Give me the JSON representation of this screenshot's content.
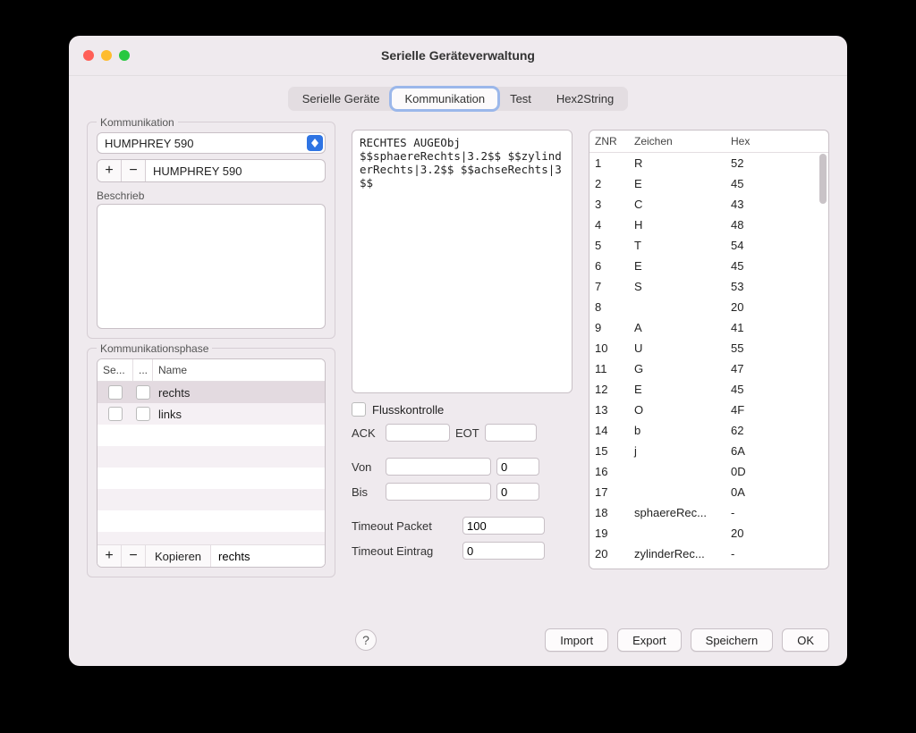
{
  "window": {
    "title": "Serielle Geräteverwaltung"
  },
  "tabs": [
    "Serielle Geräte",
    "Kommunikation",
    "Test",
    "Hex2String"
  ],
  "active_tab": 1,
  "komm": {
    "group_label": "Kommunikation",
    "device_selected": "HUMPHREY 590",
    "add_label": "+",
    "remove_label": "−",
    "device_inline": "HUMPHREY 590",
    "beschrieb_label": "Beschrieb"
  },
  "phase": {
    "group_label": "Kommunikationsphase",
    "headers": {
      "se": "Se...",
      "dots": "...",
      "name": "Name"
    },
    "rows": [
      {
        "name": "rechts",
        "selected": true
      },
      {
        "name": "links",
        "selected": false
      }
    ],
    "copy_label": "Kopieren",
    "copy_value": "rechts"
  },
  "code_text": "RECHTES AUGEObj\n$$sphaereRechts|3.2$$ $$zylinderRechts|3.2$$ $$achseRechts|3$$",
  "fluss": {
    "label": "Flusskontrolle",
    "ack_label": "ACK",
    "ack_value": "",
    "eot_label": "EOT",
    "eot_value": ""
  },
  "range": {
    "von_label": "Von",
    "von_a": "",
    "von_b": "0",
    "bis_label": "Bis",
    "bis_a": "",
    "bis_b": "0"
  },
  "timeout": {
    "packet_label": "Timeout Packet",
    "packet_value": "100",
    "eintrag_label": "Timeout Eintrag",
    "eintrag_value": "0"
  },
  "table": {
    "headers": {
      "znr": "ZNR",
      "zeichen": "Zeichen",
      "hex": "Hex"
    },
    "rows": [
      {
        "znr": "1",
        "z": "R",
        "h": "52"
      },
      {
        "znr": "2",
        "z": "E",
        "h": "45"
      },
      {
        "znr": "3",
        "z": "C",
        "h": "43"
      },
      {
        "znr": "4",
        "z": "H",
        "h": "48"
      },
      {
        "znr": "5",
        "z": "T",
        "h": "54"
      },
      {
        "znr": "6",
        "z": "E",
        "h": "45"
      },
      {
        "znr": "7",
        "z": "S",
        "h": "53"
      },
      {
        "znr": "8",
        "z": "",
        "h": "20"
      },
      {
        "znr": "9",
        "z": "A",
        "h": "41"
      },
      {
        "znr": "10",
        "z": "U",
        "h": "55"
      },
      {
        "znr": "11",
        "z": "G",
        "h": "47"
      },
      {
        "znr": "12",
        "z": "E",
        "h": "45"
      },
      {
        "znr": "13",
        "z": "O",
        "h": "4F"
      },
      {
        "znr": "14",
        "z": "b",
        "h": "62"
      },
      {
        "znr": "15",
        "z": "j",
        "h": "6A"
      },
      {
        "znr": "16",
        "z": "",
        "h": "0D"
      },
      {
        "znr": "17",
        "z": "",
        "h": "0A"
      },
      {
        "znr": "18",
        "z": "sphaereRec...",
        "h": "-"
      },
      {
        "znr": "19",
        "z": "",
        "h": "20"
      },
      {
        "znr": "20",
        "z": "zylinderRec...",
        "h": "-"
      }
    ]
  },
  "footer": {
    "help": "?",
    "import": "Import",
    "export": "Export",
    "save": "Speichern",
    "ok": "OK"
  }
}
